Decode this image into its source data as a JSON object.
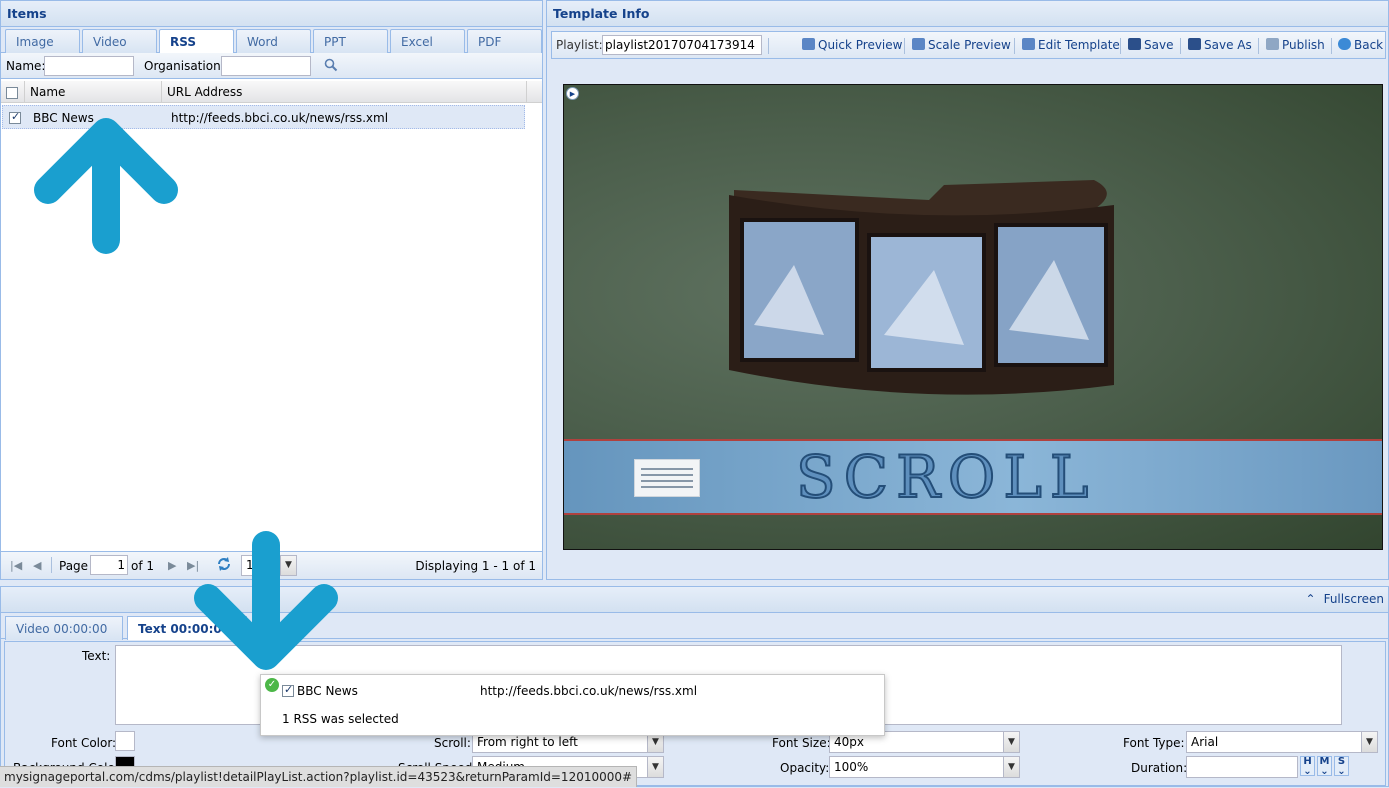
{
  "items_panel": {
    "title": "Items",
    "tabs": [
      "Image",
      "Video",
      "RSS",
      "Word",
      "PPT",
      "Excel",
      "PDF"
    ],
    "active_tab": "RSS",
    "filter": {
      "name_label": "Name:",
      "name_value": "",
      "org_label": "Organisation :",
      "org_value": ""
    },
    "columns": {
      "name": "Name",
      "url": "URL Address"
    },
    "rows": [
      {
        "name": "BBC News",
        "url": "http://feeds.bbci.co.uk/news/rss.xml",
        "checked": true
      }
    ],
    "pager": {
      "page_label": "Page",
      "page_value": "1",
      "of_label": "of 1",
      "display": "Displaying 1 - 1 of 1",
      "page_size": "1"
    }
  },
  "template_panel": {
    "title": "Template Info",
    "playlist_label": "Playlist:",
    "playlist_value": "playlist20170704173914",
    "buttons": {
      "quick_preview": "Quick Preview",
      "scale_preview": "Scale Preview",
      "edit_template": "Edit Template",
      "save": "Save",
      "save_as": "Save As",
      "publish": "Publish",
      "back": "Back"
    },
    "preview_text": "SCROLL"
  },
  "bottom_panel": {
    "fullscreen_label": "Fullscreen",
    "tabs": [
      "Video 00:00:00",
      "Text 00:00:00"
    ],
    "active_tab": "Text 00:00:00",
    "form": {
      "text_label": "Text:",
      "font_color_label": "Font Color:",
      "background_color_label": "Background Color:",
      "scroll_label": "Scroll:",
      "scroll_value": "From right to left",
      "scroll_speed_label": "Scroll Speed:",
      "scroll_speed_value": "Medium",
      "font_size_label": "Font Size:",
      "font_size_value": "40px",
      "opacity_label": "Opacity:",
      "opacity_value": "100%",
      "font_type_label": "Font Type:",
      "font_type_value": "Arial",
      "duration_label": "Duration:",
      "duration_value": "",
      "h_label": "H",
      "m_label": "M",
      "s_label": "S"
    }
  },
  "popup": {
    "name": "BBC News",
    "url": "http://feeds.bbci.co.uk/news/rss.xml",
    "message": "1 RSS was selected"
  },
  "status_url": "mysignageportal.com/cdms/playlist!detailPlayList.action?playlist.id=43523&returnParamId=12010000#",
  "colors": {
    "accent": "#15428b",
    "arrow": "#1a9fcf",
    "band_border": "#b0413e"
  }
}
